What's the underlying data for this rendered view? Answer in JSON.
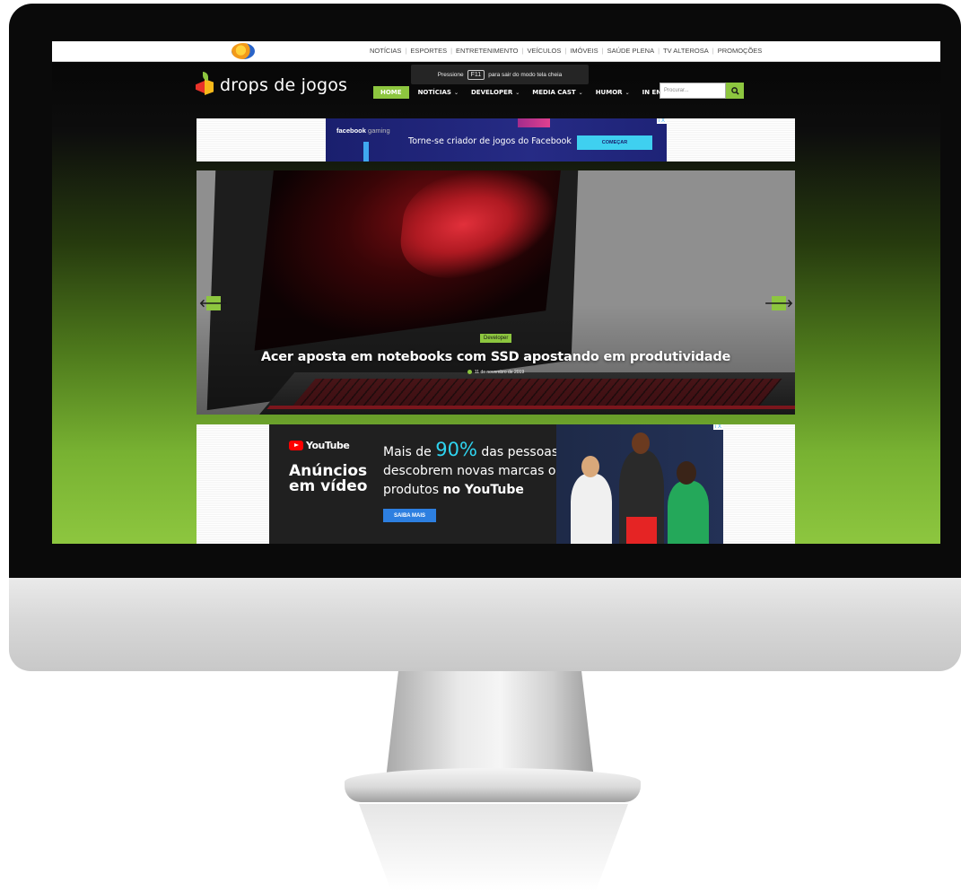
{
  "top_links": [
    "NOTÍCIAS",
    "ESPORTES",
    "ENTRETENIMENTO",
    "VEÍCULOS",
    "IMÓVEIS",
    "SAÚDE PLENA",
    "TV ALTEROSA",
    "PROMOÇÕES"
  ],
  "brand": {
    "name": "drops de jogos"
  },
  "toast": {
    "pre": "Pressione",
    "key": "F11",
    "post": "para sair do modo tela cheia"
  },
  "nav": {
    "home": "HOME",
    "noticias": "NOTÍCIAS",
    "developer": "DEVELOPER",
    "mediacast": "MEDIA CAST",
    "humor": "HUMOR",
    "english": "IN ENGLISH",
    "caret": "⌄"
  },
  "search": {
    "placeholder": "Procurar..."
  },
  "fb_ad": {
    "brand_bold": "facebook",
    "brand_light": "gaming",
    "text": "Torne-se criador de jogos do Facebook",
    "cta": "COMEÇAR",
    "adchoice": "i X"
  },
  "hero": {
    "category": "Developer",
    "title": "Acer aposta em notebooks com SSD apostando em produtividade",
    "date": "11 de novembro de 2019",
    "prev": "🡐",
    "next": "🡒"
  },
  "yt_ad": {
    "logo": "YouTube",
    "headline_1": "Anúncios",
    "headline_2": "em vídeo",
    "line1_pre": "Mais de",
    "line1_pct": "90%",
    "line1_post": "das pessoas",
    "line2": "descobrem novas marcas ou",
    "line3_pre": "produtos",
    "line3_bold": "no YouTube",
    "cta": "SAIBA MAIS",
    "adchoice": "i X"
  },
  "colors": {
    "accent": "#8dc63f",
    "fb_bg": "#262b85",
    "yt_bg": "#202020",
    "yt_pct": "#2fd4f0"
  }
}
